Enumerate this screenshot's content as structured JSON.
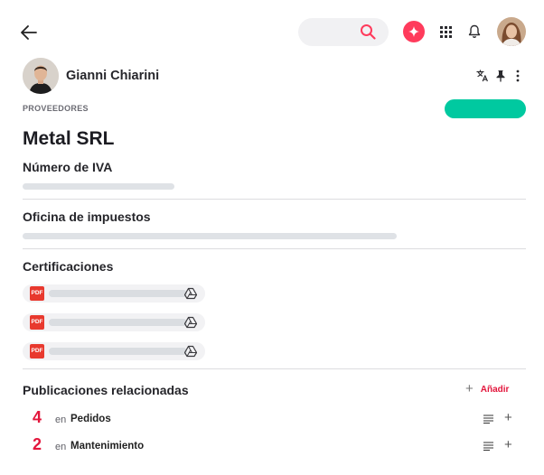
{
  "header": {
    "back_icon": "arrow-left-icon",
    "search_icon": "search-icon",
    "ai_icon": "sparkle-icon",
    "apps_icon": "grid-icon",
    "notifications_icon": "bell-icon",
    "accent_color": "#ff3b5c"
  },
  "author": {
    "name": "Gianni Chiarini"
  },
  "record": {
    "category": "PROVEEDORES",
    "title": "Metal SRL",
    "action_color": "#00c9a0"
  },
  "fields": {
    "vat_label": "Número de IVA",
    "tax_office_label": "Oficina de impuestos",
    "certifications_label": "Certificaciones",
    "certifications_file_type": "PDF"
  },
  "related": {
    "label": "Publicaciones relacionadas",
    "add_label": "Añadir",
    "items": [
      {
        "count": "4",
        "prefix": "en",
        "name": "Pedidos"
      },
      {
        "count": "2",
        "prefix": "en",
        "name": "Mantenimiento"
      }
    ]
  }
}
